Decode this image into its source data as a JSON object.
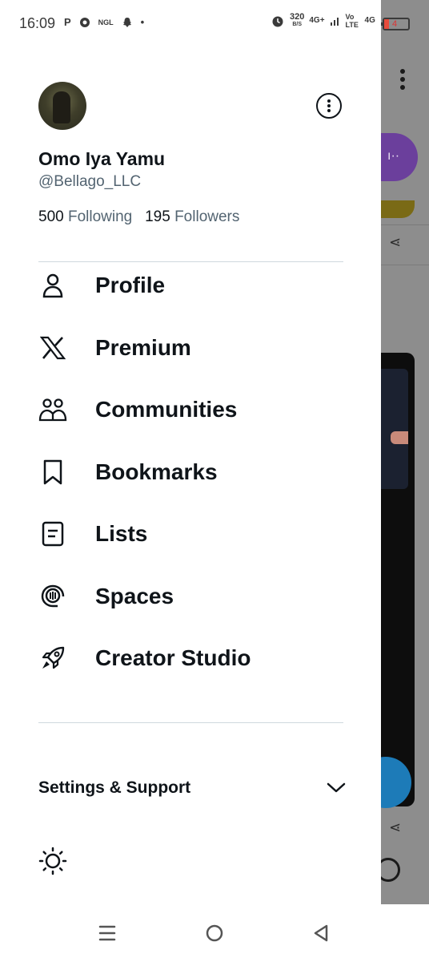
{
  "status_bar": {
    "time": "16:09",
    "left_icons": [
      "P",
      "chrome",
      "NGL",
      "snapchat",
      "•"
    ],
    "speed": "320",
    "speed_unit": "B/S",
    "net1": "4G+",
    "volte": "Vo LTE",
    "net2": "4G",
    "battery": "4"
  },
  "profile": {
    "name": "Omo Iya Yamu",
    "handle": "@Bellago_LLC",
    "following_count": "500",
    "following_label": "Following",
    "followers_count": "195",
    "followers_label": "Followers"
  },
  "menu": [
    {
      "label": "Profile",
      "icon": "person-icon"
    },
    {
      "label": "Premium",
      "icon": "x-logo-icon"
    },
    {
      "label": "Communities",
      "icon": "communities-icon"
    },
    {
      "label": "Bookmarks",
      "icon": "bookmark-icon"
    },
    {
      "label": "Lists",
      "icon": "list-icon"
    },
    {
      "label": "Spaces",
      "icon": "spaces-icon"
    },
    {
      "label": "Creator Studio",
      "icon": "rocket-icon"
    }
  ],
  "settings": {
    "label": "Settings & Support"
  },
  "colors": {
    "text": "#0f1419",
    "secondary": "#536471",
    "divider": "#cfd9de"
  }
}
